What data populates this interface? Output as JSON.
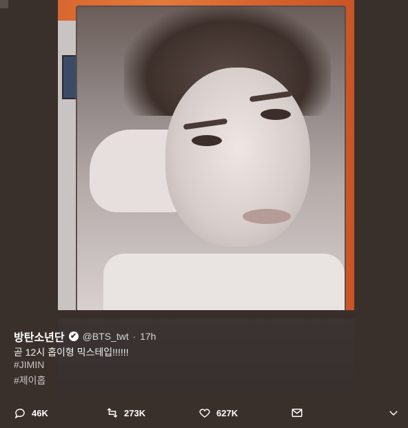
{
  "tweet": {
    "author_name": "방탄소년단",
    "handle": "@BTS_twt",
    "separator": "·",
    "time": "17h",
    "text": "곧 12시 홉이형 믹스테입!!!!!!",
    "hashtags": [
      "#JIMIN",
      "#제이홉"
    ]
  },
  "actions": {
    "reply_count": "46K",
    "retweet_count": "273K",
    "like_count": "627K"
  },
  "icons": {
    "verified": "✔"
  }
}
